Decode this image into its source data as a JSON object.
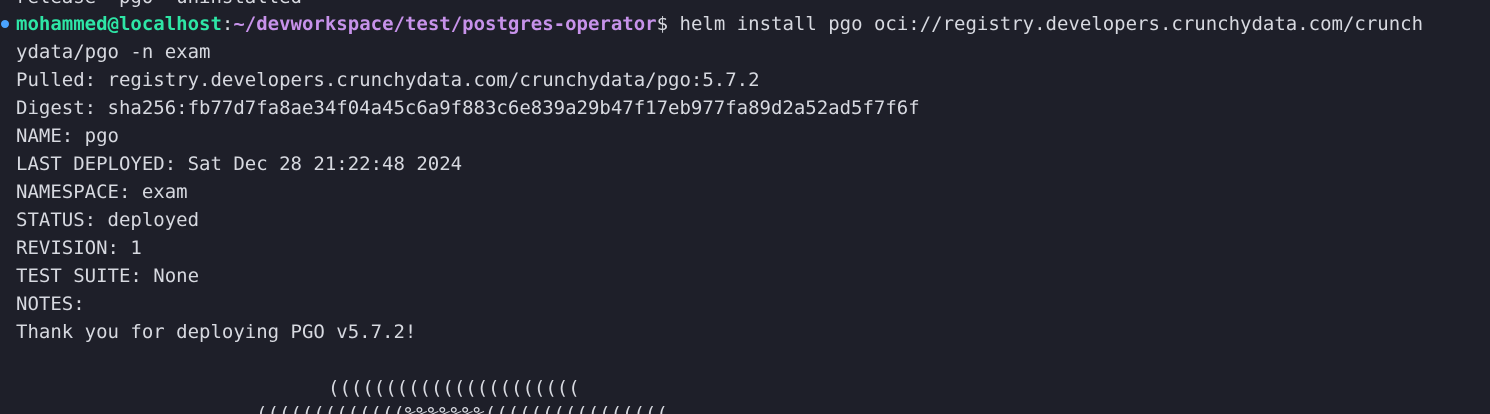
{
  "terminal": {
    "partial_top_line": "release \"pgo\" uninstalled",
    "prompt": {
      "user_host": "mohammed@localhost",
      "separator": ":",
      "path": "~/devworkspace/test/postgres-operator",
      "symbol": "$"
    },
    "command_line_1": " helm install pgo oci://registry.developers.crunchydata.com/crunch",
    "command_line_2": "ydata/pgo -n exam",
    "output": [
      "Pulled: registry.developers.crunchydata.com/crunchydata/pgo:5.7.2",
      "Digest: sha256:fb77d7fa8ae34f04a45c6a9f883c6e839a29b47f17eb977fa89d2a52ad5f7f6f",
      "NAME: pgo",
      "LAST DEPLOYED: Sat Dec 28 21:22:48 2024",
      "NAMESPACE: exam",
      "STATUS: deployed",
      "REVISION: 1",
      "TEST SUITE: None",
      "NOTES:",
      "Thank you for deploying PGO v5.7.2!"
    ],
    "ascii_art": [
      "((((((((((((((((((((((",
      "(((((((((((((%%%%%%%(((((((((((((((("
    ]
  }
}
